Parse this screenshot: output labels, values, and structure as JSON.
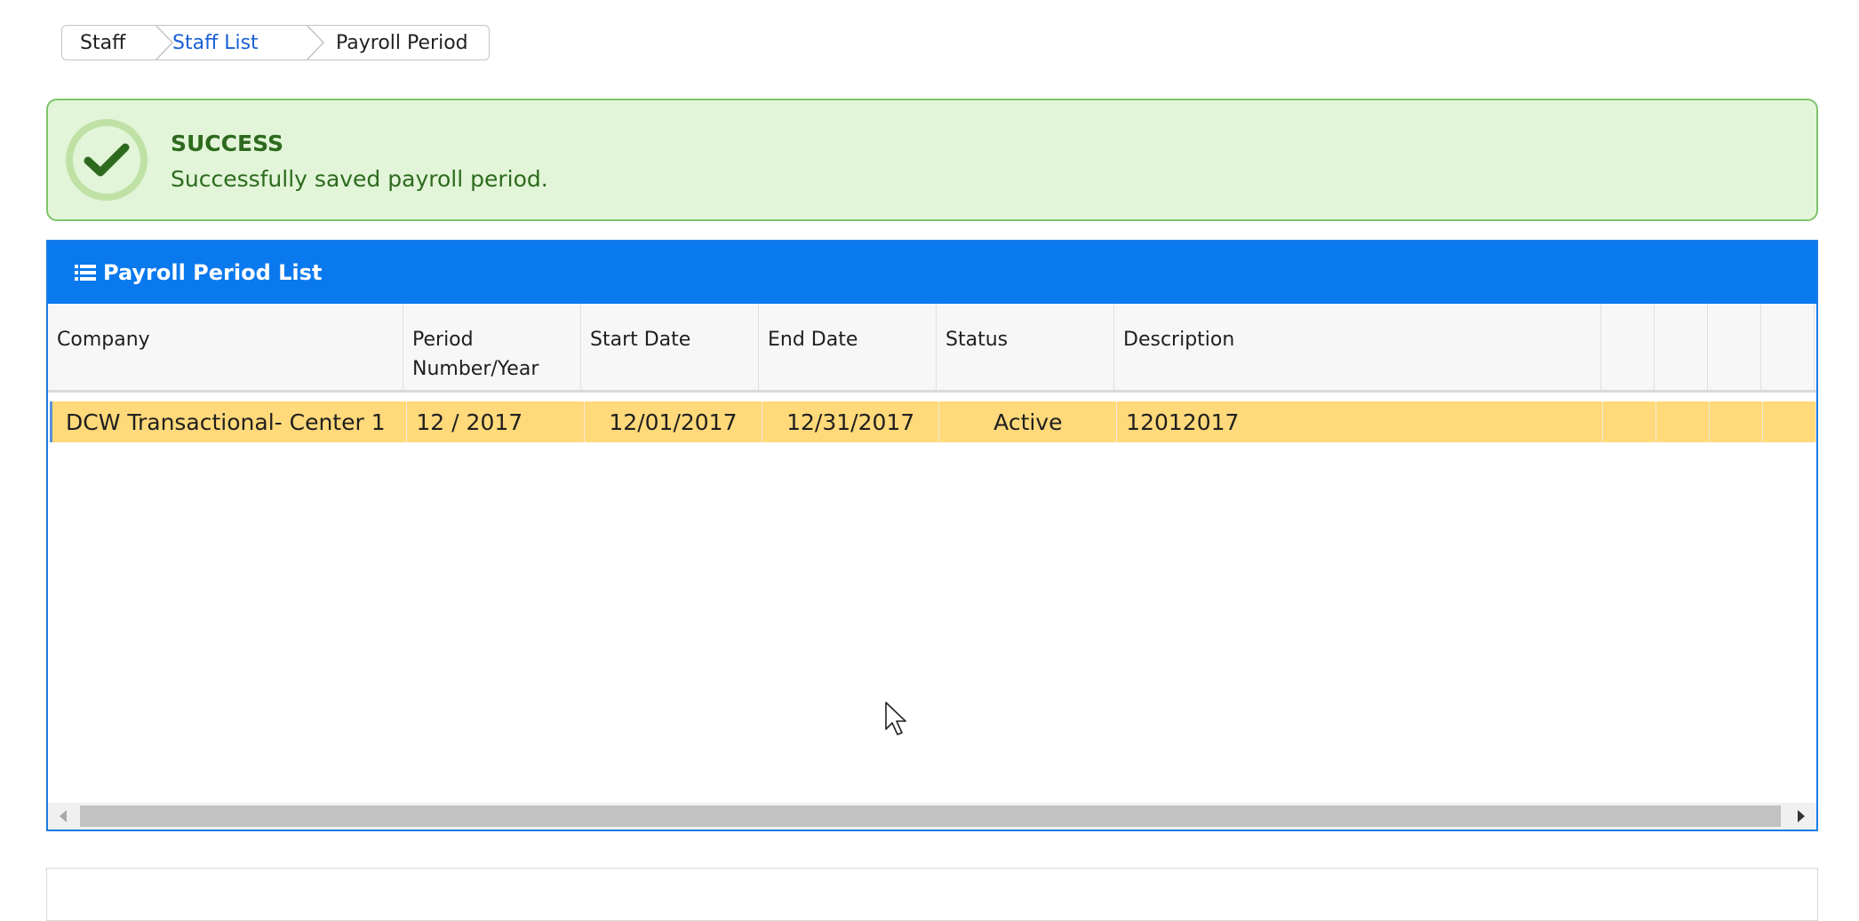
{
  "breadcrumb": {
    "items": [
      {
        "label": "Staff"
      },
      {
        "label": "Staff List"
      },
      {
        "label": "Payroll Period"
      }
    ]
  },
  "alert": {
    "title": "SUCCESS",
    "message": "Successfully saved payroll period.",
    "icon": "check-circle-icon",
    "color": "#2d6a1e"
  },
  "panel": {
    "title": "Payroll Period List",
    "icon": "list-icon",
    "accent": "#0b79ee"
  },
  "table": {
    "columns": [
      {
        "label": "Company"
      },
      {
        "label": "Period Number/Year"
      },
      {
        "label": "Start Date"
      },
      {
        "label": "End Date"
      },
      {
        "label": "Status"
      },
      {
        "label": "Description"
      }
    ],
    "rows": [
      {
        "company": "DCW Transactional- Center 1",
        "period": "12 / 2017",
        "start_date": "12/01/2017",
        "end_date": "12/31/2017",
        "status": "Active",
        "description": "12012017",
        "selected": true
      }
    ]
  }
}
